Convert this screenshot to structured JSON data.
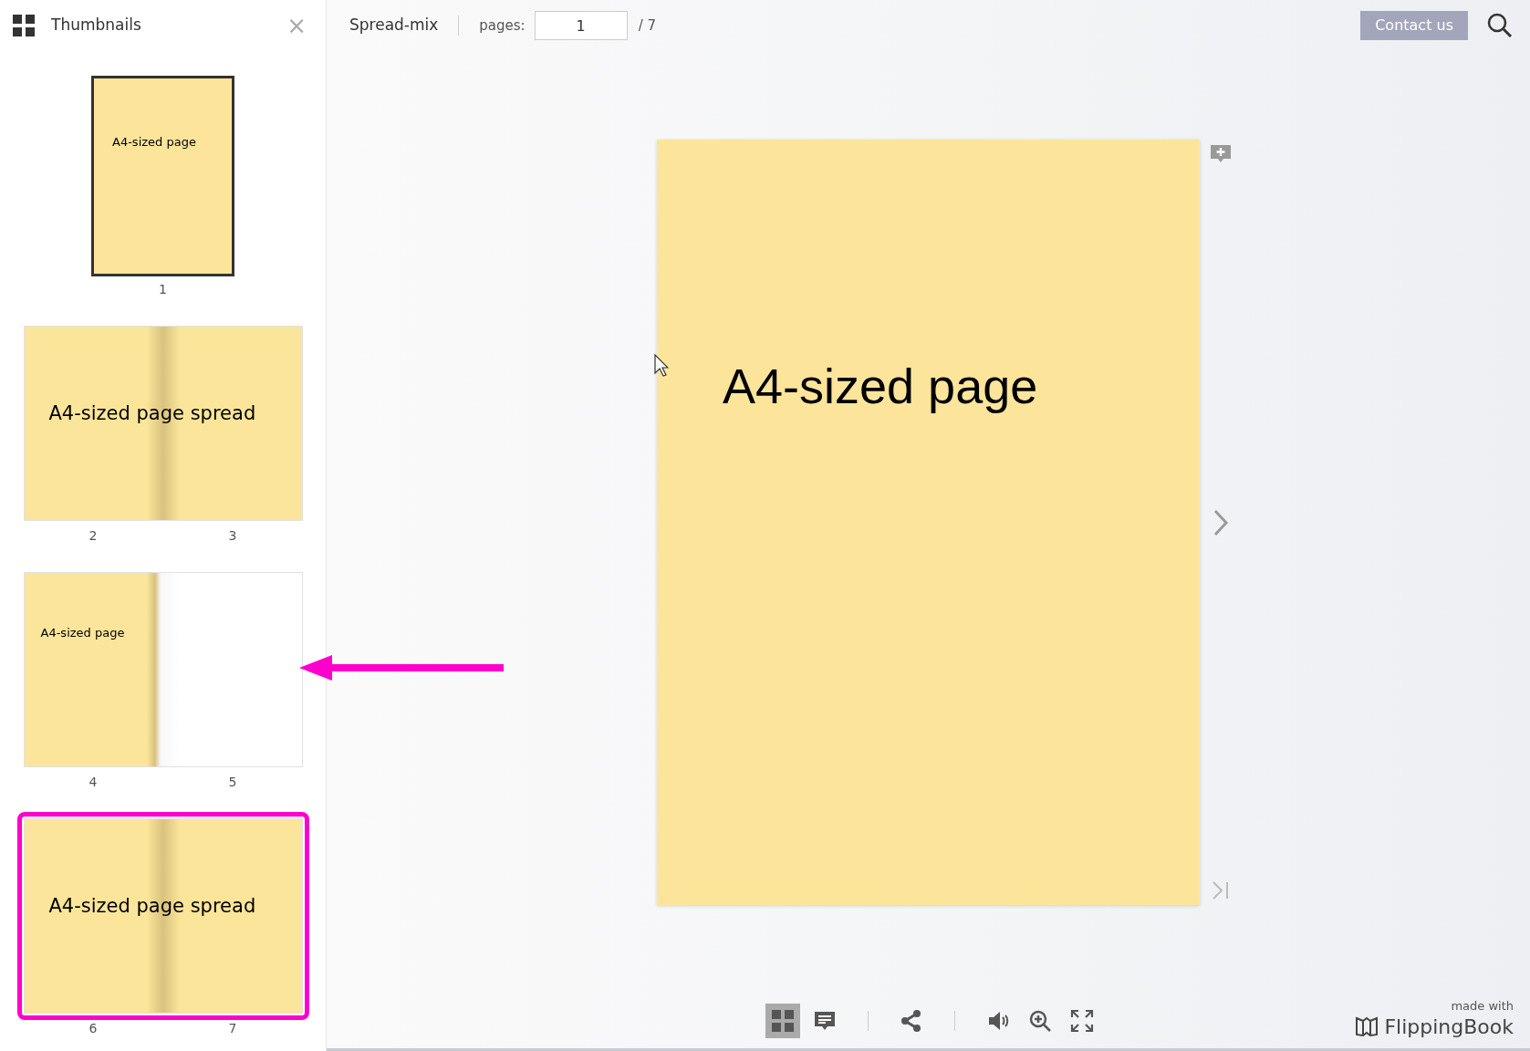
{
  "sidebar": {
    "title": "Thumbnails",
    "close": "×",
    "thumbnails": [
      {
        "kind": "single",
        "text": "A4-sized page",
        "page_numbers": [
          "1"
        ],
        "selected": true,
        "highlighted": false
      },
      {
        "kind": "spread",
        "text": "A4-sized page spread",
        "page_numbers": [
          "2",
          "3"
        ],
        "selected": false,
        "highlighted": false
      },
      {
        "kind": "left-only",
        "text": "A4-sized page",
        "page_numbers": [
          "4",
          "5"
        ],
        "selected": false,
        "highlighted": false
      },
      {
        "kind": "spread",
        "text": "A4-sized page spread",
        "page_numbers": [
          "6",
          "7"
        ],
        "selected": false,
        "highlighted": true
      }
    ]
  },
  "topbar": {
    "title": "Spread-mix",
    "pages_label": "pages:",
    "page_value": "1",
    "page_total": "/ 7",
    "contact_button": "Contact us"
  },
  "page": {
    "text": "A4-sized page"
  },
  "toolbar": [
    {
      "kind": "thumbnails",
      "selected": true
    },
    {
      "kind": "notes",
      "selected": false
    },
    {
      "kind": "divider"
    },
    {
      "kind": "share",
      "selected": false
    },
    {
      "kind": "divider"
    },
    {
      "kind": "sound",
      "selected": false
    },
    {
      "kind": "zoom",
      "selected": false
    },
    {
      "kind": "fullscreen",
      "selected": false
    }
  ],
  "branding": {
    "caption": "made with",
    "name": "FlippingBook"
  }
}
